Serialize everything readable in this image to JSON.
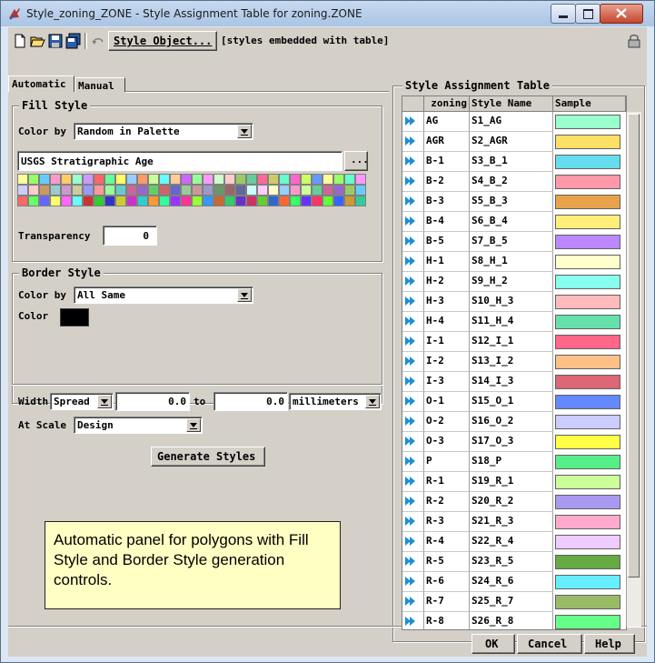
{
  "window": {
    "title": "Style_zoning_ZONE - Style Assignment Table for zoning.ZONE",
    "colors": {
      "accent": "#aac4e4",
      "close": "#c5452e"
    }
  },
  "toolbar": {
    "style_object_label": "Style Object...",
    "style_object_value": "[styles embedded with table]",
    "icons": [
      "new-icon",
      "open-icon",
      "save-icon",
      "save-as-icon",
      "undo-icon",
      "lock-icon"
    ]
  },
  "tabs": [
    {
      "label": "Automatic",
      "active": true
    },
    {
      "label": "Manual",
      "active": false
    }
  ],
  "fill_style": {
    "group_label": "Fill Style",
    "color_by_label": "Color by",
    "color_by_value": "Random in Palette",
    "palette_name": "USGS Stratigraphic Age",
    "palette_button": "...",
    "transparency_label": "Transparency",
    "transparency_value": "0",
    "palette_colors": [
      "#ffff99",
      "#99ff66",
      "#66ccff",
      "#ff99cc",
      "#ffcc66",
      "#99ffcc",
      "#cc99ff",
      "#ff6666",
      "#66ff99",
      "#ffff66",
      "#99ccff",
      "#ff9966",
      "#ccff99",
      "#66ffff",
      "#ffcc99",
      "#cc66ff",
      "#99ff99",
      "#ff99ff",
      "#ccffcc",
      "#ffcccc",
      "#99cc66",
      "#66cc99",
      "#ff6699",
      "#cccc66",
      "#66ffcc",
      "#ff66cc",
      "#ccff66",
      "#6699ff",
      "#ffff99",
      "#99ff66",
      "#66ffcc",
      "#ff99ff",
      "#ccccff",
      "#ffcccc",
      "#cc9966",
      "#99cccc",
      "#cc99cc",
      "#cccc99",
      "#9999ff",
      "#ff9999",
      "#99ff99",
      "#66cccc",
      "#cc6699",
      "#9966cc",
      "#66cc66",
      "#cc6666",
      "#6666cc",
      "#99cc99",
      "#cc9999",
      "#9999cc",
      "#669966",
      "#996666",
      "#666699",
      "#ccffff",
      "#ffccff",
      "#ffffcc",
      "#99ccff",
      "#ff99cc",
      "#ccff99",
      "#66cc99",
      "#cc6699",
      "#9966cc",
      "#99cc66",
      "#66ccff",
      "#ff6666",
      "#66ff66",
      "#6666ff",
      "#ffff66",
      "#ff66ff",
      "#66ffff",
      "#cc3333",
      "#33cc33",
      "#3333cc",
      "#cccc33",
      "#cc33cc",
      "#33cccc",
      "#ff9933",
      "#33ff99",
      "#9933ff",
      "#ff3399",
      "#99ff33",
      "#3399ff",
      "#cc6633",
      "#33cc66",
      "#6633cc",
      "#cc3366",
      "#66cc33",
      "#3366cc",
      "#ff6633",
      "#33ff66",
      "#6633ff",
      "#ff3366",
      "#66ff33",
      "#3366ff",
      "#cc9933",
      "#33cc99"
    ]
  },
  "border_style": {
    "group_label": "Border Style",
    "color_by_label": "Color by",
    "color_by_value": "All Same",
    "color_label": "Color",
    "color_value": "#000000",
    "width_label": "Width",
    "width_mode": "Spread",
    "width_from": "0.0",
    "width_to_label": "to",
    "width_to": "0.0",
    "width_units": "millimeters",
    "at_scale_label": "At Scale",
    "at_scale_value": "Design"
  },
  "generate_button": "Generate Styles",
  "annotation": "Automatic panel for polygons with Fill Style and Border Style generation controls.",
  "table": {
    "group_label": "Style Assignment Table",
    "headers": [
      "zoning",
      "Style Name",
      "Sample"
    ],
    "rows": [
      {
        "code": "AG",
        "style": "S1_AG",
        "color": "#99ffcc"
      },
      {
        "code": "AGR",
        "style": "S2_AGR",
        "color": "#ffe066"
      },
      {
        "code": "B-1",
        "style": "S3_B_1",
        "color": "#66ddee"
      },
      {
        "code": "B-2",
        "style": "S4_B_2",
        "color": "#ff99aa"
      },
      {
        "code": "B-3",
        "style": "S5_B_3",
        "color": "#e8a24a"
      },
      {
        "code": "B-4",
        "style": "S6_B_4",
        "color": "#ffee77"
      },
      {
        "code": "B-5",
        "style": "S7_B_5",
        "color": "#bb88ff"
      },
      {
        "code": "H-1",
        "style": "S8_H_1",
        "color": "#ffffcc"
      },
      {
        "code": "H-2",
        "style": "S9_H_2",
        "color": "#88ffee"
      },
      {
        "code": "H-3",
        "style": "S10_H_3",
        "color": "#ffbbbb"
      },
      {
        "code": "H-4",
        "style": "S11_H_4",
        "color": "#66e0aa"
      },
      {
        "code": "I-1",
        "style": "S12_I_1",
        "color": "#ff6688"
      },
      {
        "code": "I-2",
        "style": "S13_I_2",
        "color": "#ffc088"
      },
      {
        "code": "I-3",
        "style": "S14_I_3",
        "color": "#dd6677"
      },
      {
        "code": "O-1",
        "style": "S15_O_1",
        "color": "#6688ff"
      },
      {
        "code": "O-2",
        "style": "S16_O_2",
        "color": "#ccccff"
      },
      {
        "code": "O-3",
        "style": "S17_O_3",
        "color": "#ffff44"
      },
      {
        "code": "P",
        "style": "S18_P",
        "color": "#55ee88"
      },
      {
        "code": "R-1",
        "style": "S19_R_1",
        "color": "#ccff99"
      },
      {
        "code": "R-2",
        "style": "S20_R_2",
        "color": "#aa99ee"
      },
      {
        "code": "R-3",
        "style": "S21_R_3",
        "color": "#ffaacc"
      },
      {
        "code": "R-4",
        "style": "S22_R_4",
        "color": "#eeccff"
      },
      {
        "code": "R-5",
        "style": "S23_R_5",
        "color": "#66aa44"
      },
      {
        "code": "R-6",
        "style": "S24_R_6",
        "color": "#66eeff"
      },
      {
        "code": "R-7",
        "style": "S25_R_7",
        "color": "#99bb66"
      },
      {
        "code": "R-8",
        "style": "S26_R_8",
        "color": "#66ff88"
      }
    ]
  },
  "footer": {
    "ok": "OK",
    "cancel": "Cancel",
    "help": "Help"
  }
}
